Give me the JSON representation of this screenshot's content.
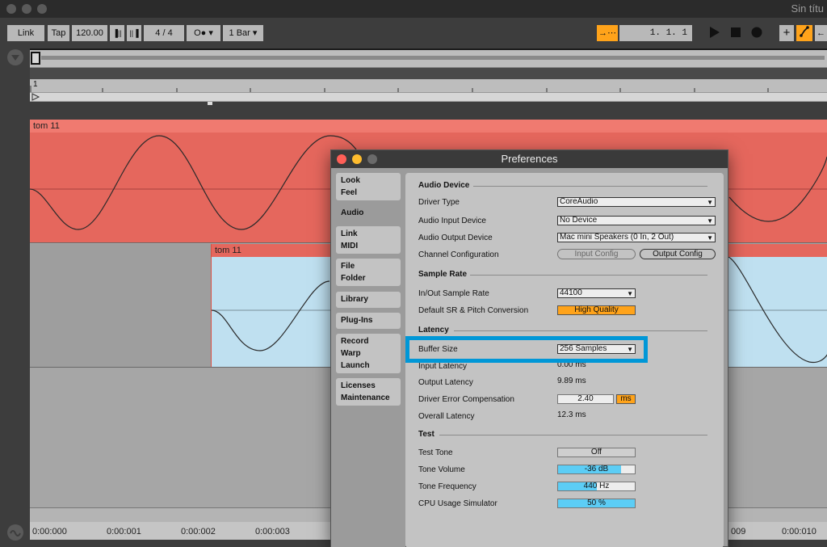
{
  "window": {
    "title": "Sin títu"
  },
  "control_bar": {
    "link": "Link",
    "tap": "Tap",
    "tempo": "120.00",
    "nudge_down": "▐||",
    "nudge_up": "||▐",
    "time_sig_num": "4",
    "time_sig_sep": "/",
    "time_sig_den": "4",
    "metronome": "O●",
    "quantize": "1 Bar",
    "position": "1.   1.   1",
    "plus": "+"
  },
  "arrangement": {
    "beat_marker": "1",
    "clip1_name": "tom 11",
    "clip2_name": "tom 11",
    "time_labels": [
      "0:00:000",
      "0:00:001",
      "0:00:002",
      "0:00:003",
      "009",
      "0:00:010"
    ]
  },
  "preferences": {
    "title": "Preferences",
    "tabs": [
      "Look\nFeel",
      "Audio",
      "Link\nMIDI",
      "File\nFolder",
      "Library",
      "Plug-Ins",
      "Record\nWarp\nLaunch",
      "Licenses\nMaintenance"
    ],
    "active_tab": "Audio",
    "sections": {
      "audio_device": "Audio Device",
      "sample_rate": "Sample Rate",
      "latency": "Latency",
      "test": "Test"
    },
    "labels": {
      "driver_type": "Driver Type",
      "audio_input_device": "Audio Input Device",
      "audio_output_device": "Audio Output Device",
      "channel_configuration": "Channel Configuration",
      "in_out_sample_rate": "In/Out Sample Rate",
      "default_sr": "Default SR & Pitch Conversion",
      "buffer_size": "Buffer Size",
      "input_latency": "Input Latency",
      "output_latency": "Output Latency",
      "driver_error_comp": "Driver Error Compensation",
      "overall_latency": "Overall Latency",
      "test_tone": "Test Tone",
      "tone_volume": "Tone Volume",
      "tone_frequency": "Tone Frequency",
      "cpu_usage_simulator": "CPU Usage Simulator"
    },
    "values": {
      "driver_type": "CoreAudio",
      "audio_input_device": "No Device",
      "audio_output_device": "Mac mini Speakers (0 In, 2 Out)",
      "input_config": "Input Config",
      "output_config": "Output Config",
      "in_out_sample_rate": "44100",
      "default_sr": "High Quality",
      "buffer_size": "256 Samples",
      "input_latency": "0.00 ms",
      "output_latency": "9.89 ms",
      "driver_error_comp": "2.40",
      "driver_error_unit": "ms",
      "overall_latency": "12.3 ms",
      "test_tone": "Off",
      "tone_volume": "-36",
      "tone_volume_unit": "dB",
      "tone_frequency": "440",
      "tone_frequency_unit": "Hz",
      "cpu_usage": "50 %"
    },
    "fills": {
      "tone_volume": 0.82,
      "tone_frequency": 0.5,
      "cpu_usage": 1.0
    }
  },
  "colors": {
    "accent_orange": "#ffa31a",
    "clip_red": "#e5675d",
    "clip_blue": "#bfe0f0",
    "highlight_blue": "#0097d7",
    "value_cyan": "#5ccdf5"
  }
}
